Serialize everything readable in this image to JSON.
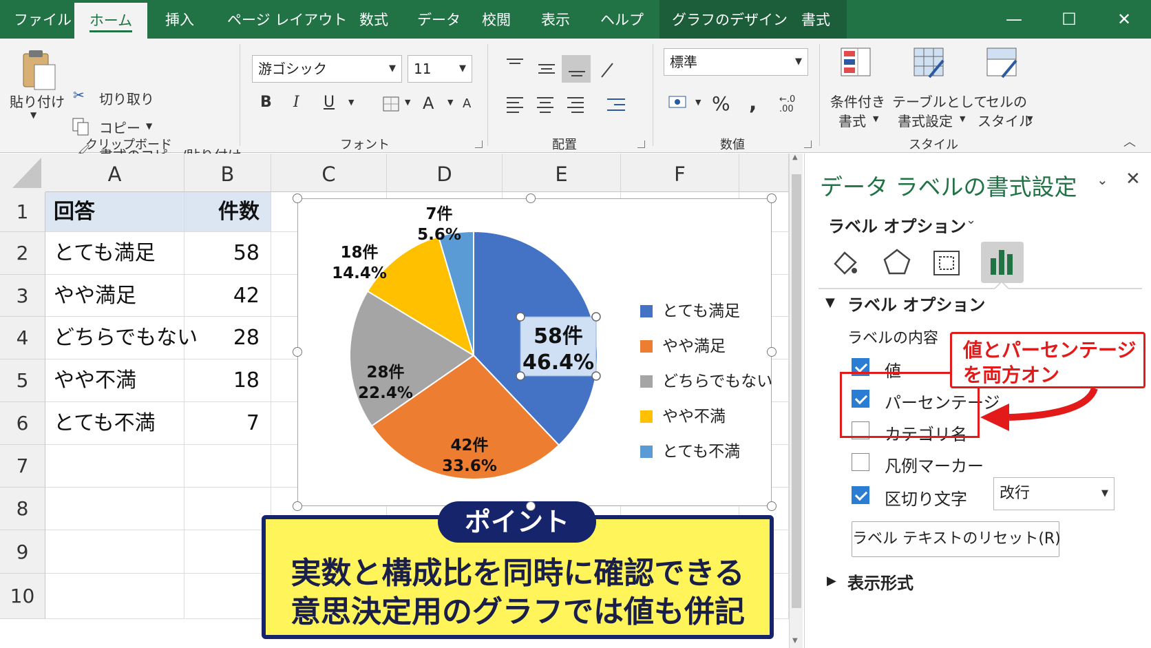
{
  "tabs": [
    "ファイル",
    "ホーム",
    "挿入",
    "ページ レイアウト",
    "数式",
    "データ",
    "校閲",
    "表示",
    "ヘルプ",
    "グラフのデザイン",
    "書式"
  ],
  "window_controls": {
    "minimize": "—",
    "maximize": "☐",
    "close": "✕"
  },
  "ribbon": {
    "clipboard": {
      "paste": "貼り付け",
      "cut": "切り取り",
      "copy": "コピー",
      "format_painter": "書式のコピー/貼り付け",
      "group": "クリップボード"
    },
    "font": {
      "name": "游ゴシック",
      "size": "11",
      "bold": "B",
      "italic": "I",
      "underline": "U",
      "grow": "A",
      "shrink": "A",
      "group": "フォント"
    },
    "alignment": {
      "group": "配置"
    },
    "number": {
      "format": "標準",
      "percent": "%",
      "comma": ",",
      "decimal": "←.0\n.00",
      "group": "数値"
    },
    "styles": {
      "conditional_1": "条件付き",
      "conditional_2": "書式",
      "table_1": "テーブルとして",
      "table_2": "書式設定",
      "cell_1": "セルの",
      "cell_2": "スタイル",
      "group": "スタイル"
    }
  },
  "sheet": {
    "columns": [
      "A",
      "B",
      "C",
      "D",
      "E",
      "F"
    ],
    "rows": [
      "1",
      "2",
      "3",
      "4",
      "5",
      "6",
      "7",
      "8",
      "9",
      "10"
    ],
    "header": {
      "a": "回答",
      "b": "件数"
    },
    "data": [
      {
        "a": "とても満足",
        "b": "58"
      },
      {
        "a": "やや満足",
        "b": "42"
      },
      {
        "a": "どちらでもない",
        "b": "28"
      },
      {
        "a": "やや不満",
        "b": "18"
      },
      {
        "a": "とても不満",
        "b": "7"
      }
    ]
  },
  "chart_data": {
    "type": "pie",
    "categories": [
      "とても満足",
      "やや満足",
      "どちらでもない",
      "やや不満",
      "とても不満"
    ],
    "values": [
      58,
      42,
      28,
      18,
      7
    ],
    "labels": [
      {
        "count": "58件",
        "pct": "46.4%"
      },
      {
        "count": "42件",
        "pct": "33.6%"
      },
      {
        "count": "28件",
        "pct": "22.4%"
      },
      {
        "count": "18件",
        "pct": "14.4%"
      },
      {
        "count": "7件",
        "pct": "5.6%"
      }
    ],
    "colors": [
      "#4472c4",
      "#ed7d31",
      "#a5a5a5",
      "#ffc000",
      "#5b9bd5"
    ],
    "legend": "right"
  },
  "panel": {
    "title": "データ ラベルの書式設定",
    "options_dropdown": "ラベル オプション",
    "section": "ラベル オプション",
    "contents_label": "ラベルの内容",
    "checkboxes": [
      {
        "label": "値",
        "checked": true
      },
      {
        "label": "パーセンテージ",
        "checked": true
      },
      {
        "label": "カテゴリ名",
        "checked": false
      },
      {
        "label": "凡例マーカー",
        "checked": false
      },
      {
        "label": "区切り文字",
        "checked": true
      }
    ],
    "separator_value": "改行",
    "reset_button": "ラベル テキストのリセット(R)",
    "number_section": "表示形式"
  },
  "annotation": {
    "note_line1": "値とパーセンテージ",
    "note_line2": "を両方オン",
    "point_tag": "ポイント",
    "point_line1": "実数と構成比を同時に確認できる",
    "point_line2": "意思決定用のグラフでは値も併記"
  }
}
